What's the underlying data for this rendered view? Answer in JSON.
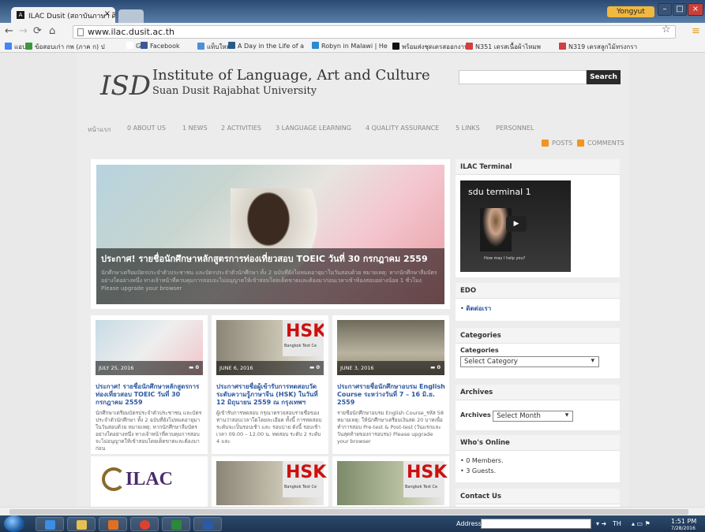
{
  "browser": {
    "tab_title": "ILAC Dusit (สถาบันภาษา ศิล",
    "tab_favicon": "A",
    "user_name": "Yongyut",
    "url": "www.ilac.dusit.ac.th",
    "bookmarks": [
      {
        "label": "แอป",
        "color": "#4285f4"
      },
      {
        "label": "ข้อสอบเก่า กพ (ภาค ก) ป",
        "color": "#3a9a3a"
      },
      {
        "label": "G",
        "color": "#ffffff"
      },
      {
        "label": "Facebook",
        "color": "#3b5998"
      },
      {
        "label": "แท็บใหม่",
        "color": "#4a90d9"
      },
      {
        "label": "A Day in the Life of a",
        "color": "#2a5a8a"
      },
      {
        "label": "Robyn in Malawi | He",
        "color": "#2a8ad0"
      },
      {
        "label": "พร้อมส่งชุดเดรสออกงาน",
        "color": "#111111"
      },
      {
        "label": "N351 เดรสเนื้อผ้าไหมพ",
        "color": "#d04040"
      },
      {
        "label": "N319 เดรสลูกไม้ทรงกรา",
        "color": "#d04040"
      }
    ]
  },
  "site": {
    "logo_mark": "ISD",
    "title_line1": "Institute of Language, Art and Culture",
    "title_line2": "Suan Dusit Rajabhat University",
    "search_button": "Search",
    "menu": [
      "หน้าแรก",
      "0 ABOUT US",
      "1 NEWS",
      "2 ACTIVITIES",
      "3 LANGUAGE LEARNING",
      "4 QUALITY ASSURANCE",
      "5 LINKS",
      "PERSONNEL"
    ],
    "feed_posts": "POSTS",
    "feed_comments": "COMMENTS",
    "slider": {
      "title": "ประกาศ! รายชื่อนักศึกษาหลักสูตรการท่องเที่ยวสอบ TOEIC วันที่ 30 กรกฎาคม 2559",
      "excerpt": "นักศึกษาเตรียมบัตรประจำตัวประชาชน และบัตรประจำตัวนักศึกษา ทั้ง 2 ฉบับที่ยังไม่หมดอายุมาในวันสอบด้วย หมายเหตุ: หากนักศึกษาลืมบัตรอย่างใดอย่างหนึ่ง ทางเจ้าหน้าที่ควบคุมการสอบจะไม่อนุญาตให้เข้าสอบโดยเด็ดขาดและต้องมาก่อนเวลาเข้าห้องสอบอย่างน้อย 1 ชั่วโมง Please upgrade your browser"
    },
    "cards": [
      {
        "date": "JULY 25, 2016",
        "comments": "0",
        "title": "ประกาศ! รายชื่อนักศึกษาหลักสูตรการท่องเที่ยวสอบ TOEIC วันที่ 30 กรกฎาคม 2559",
        "excerpt": "นักศึกษาเตรียมบัตรประจำตัวประชาชน และบัตรประจำตัวนักศึกษา ทั้ง 2 ฉบับที่ยังไม่หมดอายุมาในวันสอบด้วย หมายเหตุ: หากนักศึกษาลืมบัตรอย่างใดอย่างหนึ่ง ทางเจ้าหน้าที่ควบคุมการสอบจะไม่อนุญาตให้เข้าสอบโดยเด็ดขาดและต้องมาก่อน"
      },
      {
        "date": "JUNE 6, 2016",
        "comments": "0",
        "title": "ประกาศรายชื่อผู้เข้ารับการทดสอบวัดระดับความรู้ภาษาจีน (HSK) ในวันที่ 12 มิถุนายน 2559 ณ กรุงเทพฯ",
        "excerpt": "ผู้เข้ารับการทดสอบ กรุณาตรวจสอบรายชื่อของท่านว่าสอบเวลาใดโดยละเอียด ทั้งนี้ การทดสอบระดับจะเป็นรอบเช้า และ รอบบ่าย ดังนี้ รอบเช้า เวลา 09.00 – 12.00 น. ทดสอบ ระดับ 2 ระดับ 4 และ"
      },
      {
        "date": "JUNE 3, 2016",
        "comments": "0",
        "title": "ประกาศรายชื่อนักศึกษาอบรม English Course ระหว่างวันที่ 7 – 16 มิ.ย. 2559",
        "excerpt": "รายชื่อนักศึกษาอบรม English Course_รหัส 58 หมายเหตุ: ให้นักศึกษาเตรียมเงินสด 20 บาทเพื่อทำการสอบ Pre-test & Post-test (วันแรกและวันสุดท้ายของการอบรม) Please upgrade your browser"
      }
    ],
    "hsk": {
      "word": "HSK",
      "caption": "Bangkok Test Ce"
    },
    "ilac_logo": "ILAC",
    "widgets": {
      "terminal": {
        "title": "ILAC Terminal",
        "video_title": "sdu terminal 1",
        "video_caption": "How may I help you?"
      },
      "edo": {
        "title": "EDO",
        "link": "ติดต่อเรา"
      },
      "categories": {
        "title": "Categories",
        "label": "Categories",
        "select": "Select Category"
      },
      "archives": {
        "title": "Archives",
        "label": "Archives",
        "select": "Select Month"
      },
      "online": {
        "title": "Who's Online",
        "members": "0 Members.",
        "guests": "3 Guests."
      },
      "contact": {
        "title": "Contact Us"
      }
    }
  },
  "taskbar": {
    "address_label": "Address",
    "lang": "TH",
    "time": "1:51 PM",
    "date": "7/28/2016"
  }
}
